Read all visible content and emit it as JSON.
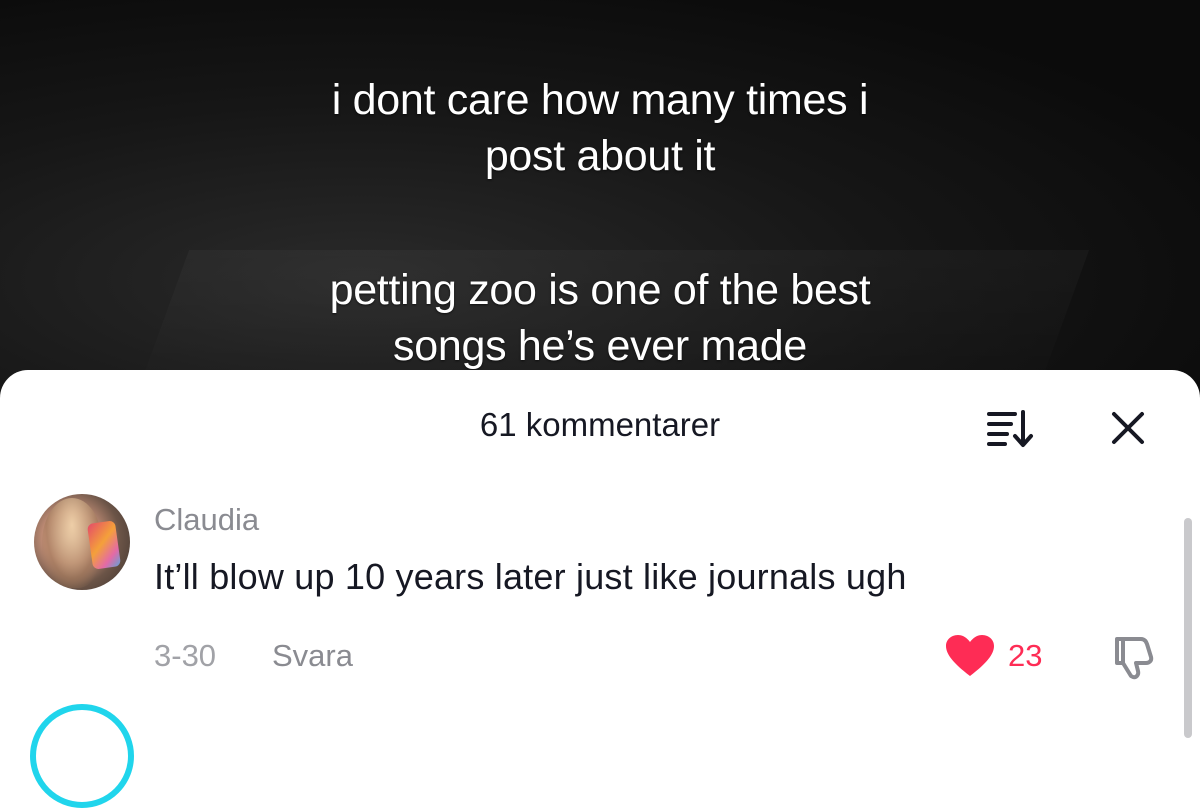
{
  "video": {
    "caption_line_1": "i dont care how many times i",
    "caption_line_2": "post about it",
    "caption_line_3": "petting zoo is one of the best",
    "caption_line_4": "songs he’s ever made"
  },
  "comments_sheet": {
    "title": "61 kommentarer",
    "sort_icon": "sort-descending-icon",
    "close_icon": "close-icon"
  },
  "comments": [
    {
      "username": "Claudia",
      "text": "It’ll blow up 10 years later just like journals ugh",
      "date": "3-30",
      "reply_label": "Svara",
      "likes": "23",
      "liked": true
    }
  ],
  "colors": {
    "like_red": "#fe2c55",
    "story_ring": "#20d5ec",
    "username_gray": "#8a8b91"
  }
}
